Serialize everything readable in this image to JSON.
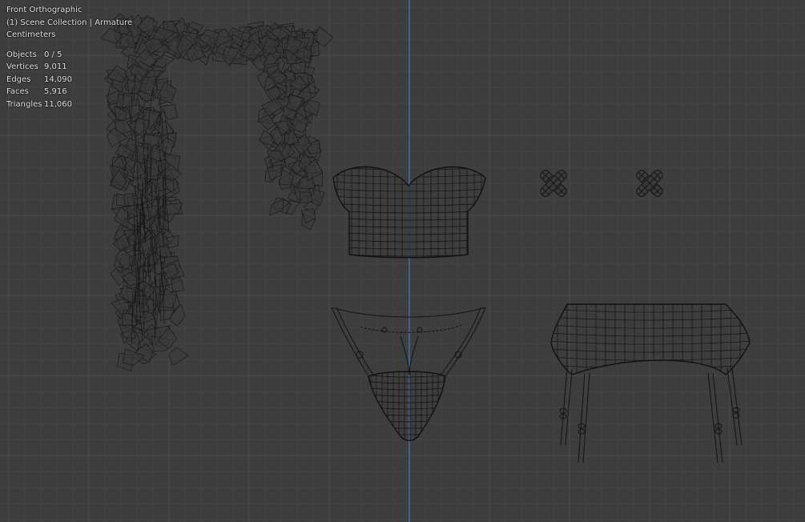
{
  "viewport": {
    "view_name": "Front Orthographic",
    "collection": "(1) Scene Collection | Armature",
    "units": "Centimeters",
    "stats": [
      {
        "label": "Objects",
        "value": "0 / 5"
      },
      {
        "label": "Vertices",
        "value": "9,011"
      },
      {
        "label": "Edges",
        "value": "14,090"
      },
      {
        "label": "Faces",
        "value": "5,916"
      },
      {
        "label": "Triangles",
        "value": "11,060"
      }
    ]
  },
  "colors": {
    "background": "#3d3d3d",
    "grid_minor": "#444444",
    "grid_major": "#4c4c4c",
    "axis_z": "#3f6fa8",
    "wire": "#161616",
    "text": "#e6e6e6"
  },
  "objects": [
    "boa-mesh",
    "bustier-mesh",
    "pastie-left-mesh",
    "pastie-right-mesh",
    "thong-mesh",
    "garter-belt-mesh"
  ]
}
